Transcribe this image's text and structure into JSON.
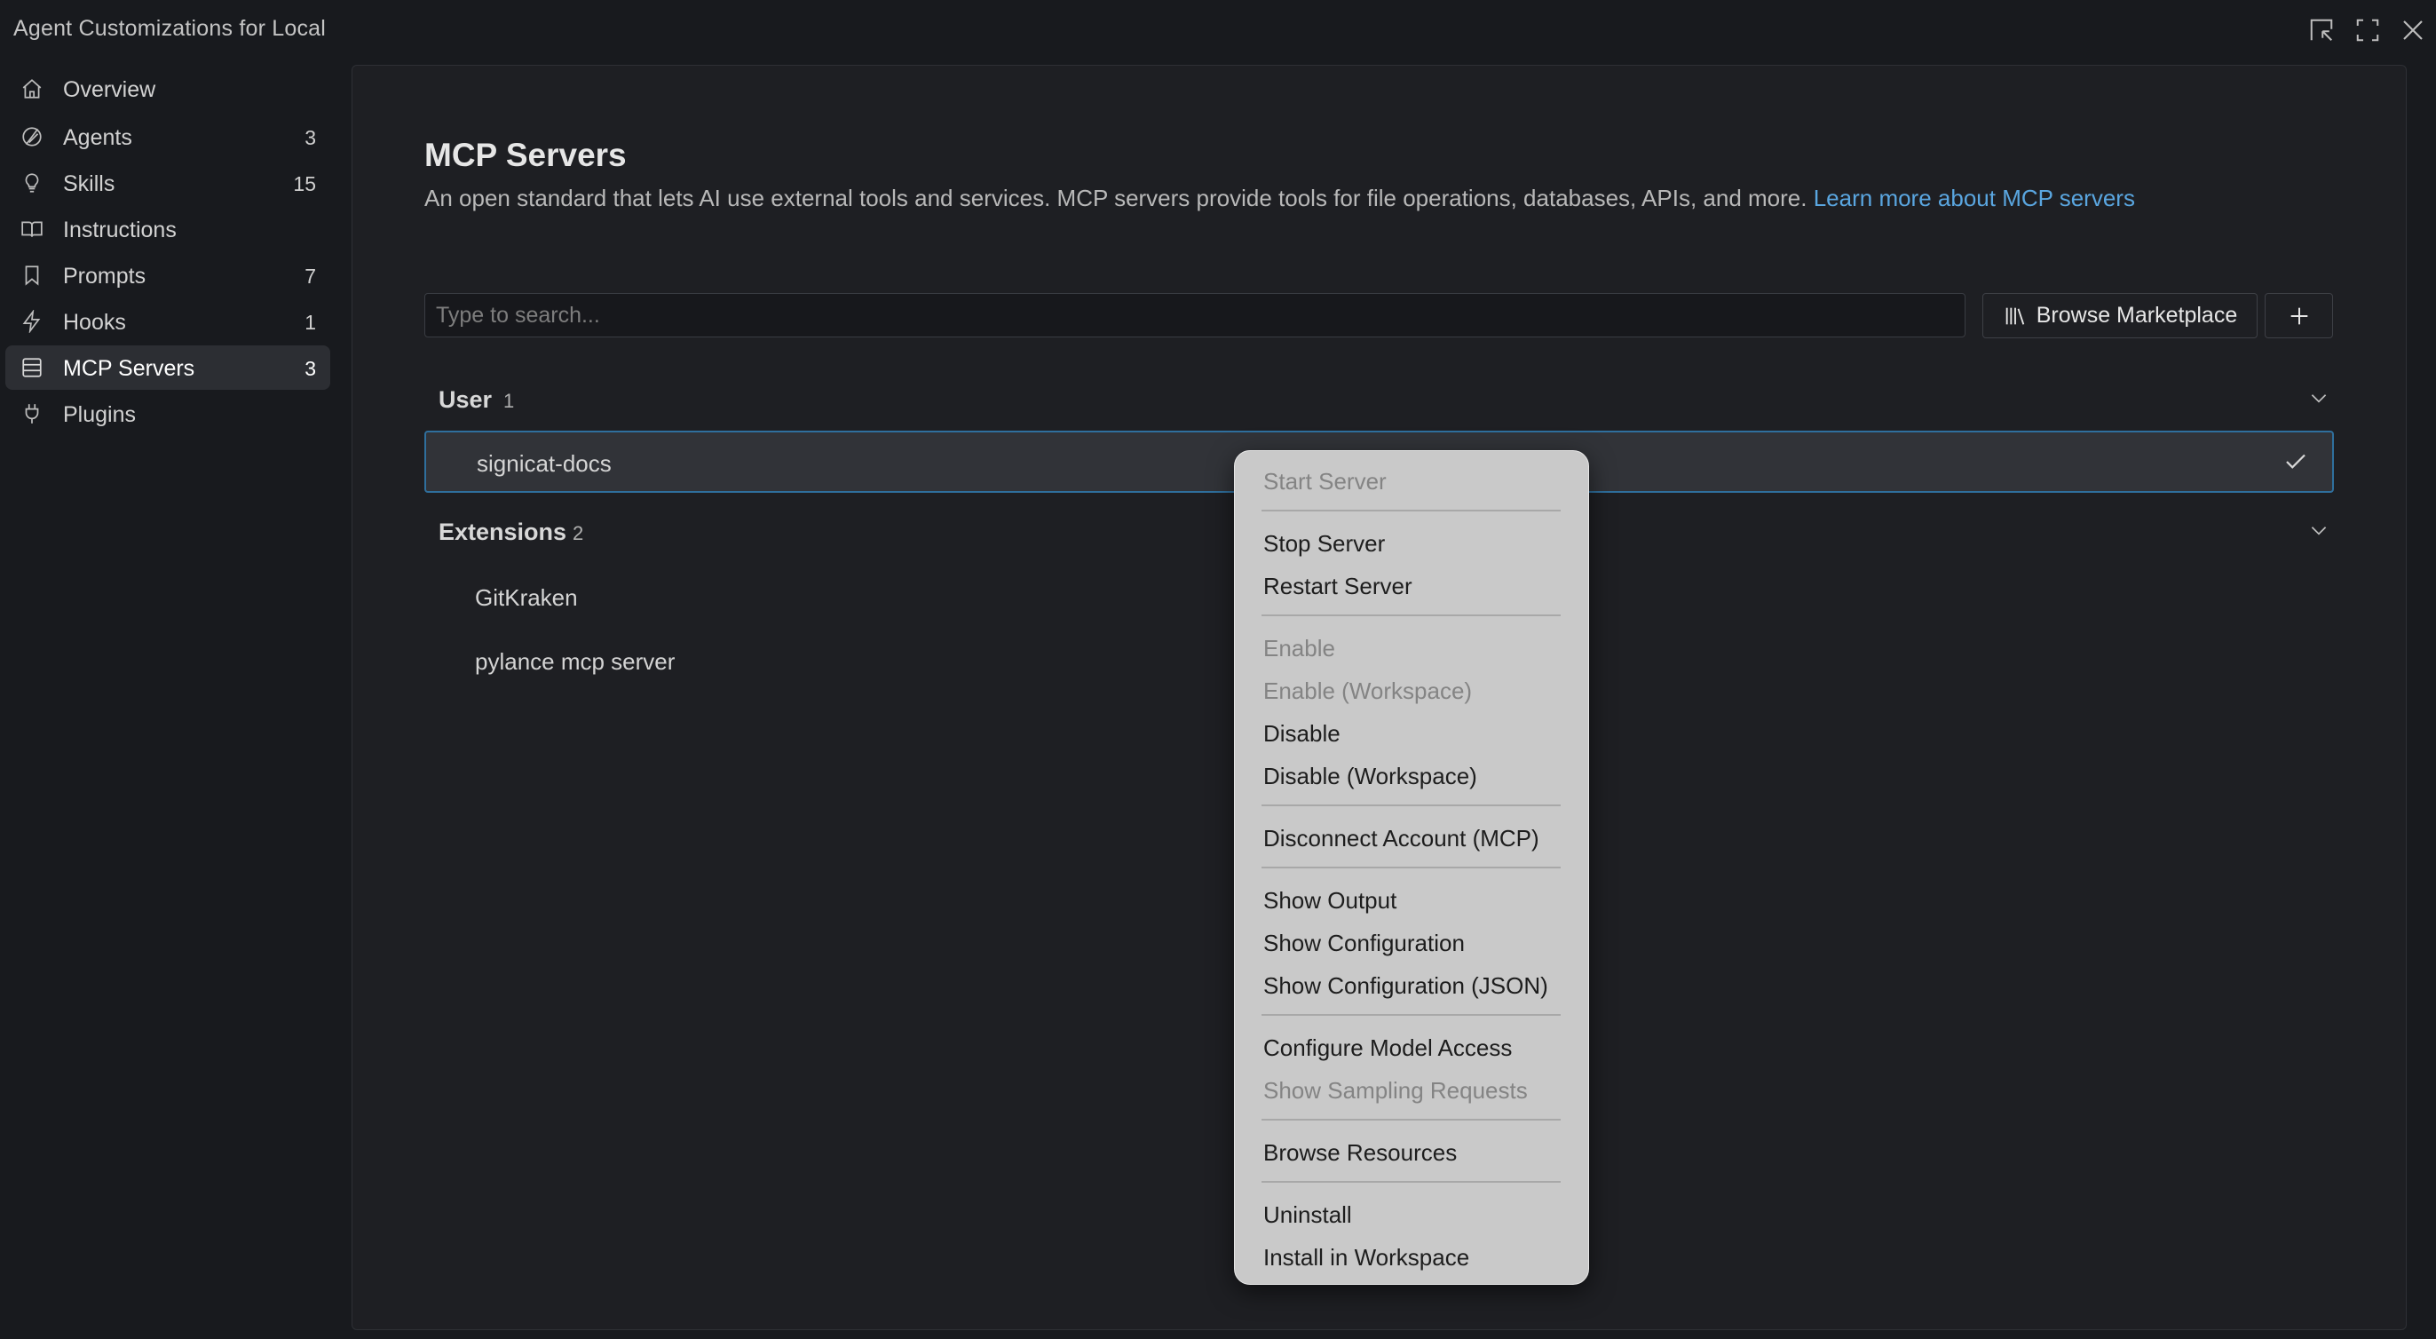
{
  "window": {
    "title": "Agent Customizations for Local",
    "controls": [
      "pin-icon",
      "maximize-icon",
      "close-icon"
    ]
  },
  "sidebar": {
    "items": [
      {
        "label": "Overview",
        "count": "",
        "icon": "home-icon"
      },
      {
        "label": "Agents",
        "count": "3",
        "icon": "agent-icon"
      },
      {
        "label": "Skills",
        "count": "15",
        "icon": "lightbulb-icon"
      },
      {
        "label": "Instructions",
        "count": "",
        "icon": "book-icon"
      },
      {
        "label": "Prompts",
        "count": "7",
        "icon": "bookmark-icon"
      },
      {
        "label": "Hooks",
        "count": "1",
        "icon": "lightning-icon"
      },
      {
        "label": "MCP Servers",
        "count": "3",
        "icon": "server-icon",
        "active": true
      },
      {
        "label": "Plugins",
        "count": "",
        "icon": "plug-icon"
      }
    ]
  },
  "main": {
    "title": "MCP Servers",
    "description": "An open standard that lets AI use external tools and services. MCP servers provide tools for file operations, databases, APIs, and more.",
    "learn_more": "Learn more about MCP servers",
    "search_placeholder": "Type to search...",
    "search_value": "",
    "browse_label": "Browse Marketplace",
    "sections": [
      {
        "name": "User",
        "count": "1",
        "servers": [
          {
            "name": "signicat-docs",
            "selected": true
          }
        ]
      },
      {
        "name": "Extensions",
        "count": "2",
        "servers": [
          {
            "name": "GitKraken"
          },
          {
            "name": "pylance mcp server"
          }
        ]
      }
    ]
  },
  "context_menu": {
    "groups": [
      [
        {
          "label": "Start Server",
          "disabled": true
        }
      ],
      [
        {
          "label": "Stop Server"
        },
        {
          "label": "Restart Server"
        }
      ],
      [
        {
          "label": "Enable",
          "disabled": true
        },
        {
          "label": "Enable (Workspace)",
          "disabled": true
        },
        {
          "label": "Disable"
        },
        {
          "label": "Disable (Workspace)"
        }
      ],
      [
        {
          "label": "Disconnect Account (MCP)"
        }
      ],
      [
        {
          "label": "Show Output"
        },
        {
          "label": "Show Configuration"
        },
        {
          "label": "Show Configuration (JSON)"
        }
      ],
      [
        {
          "label": "Configure Model Access"
        },
        {
          "label": "Show Sampling Requests",
          "disabled": true
        }
      ],
      [
        {
          "label": "Browse Resources"
        }
      ],
      [
        {
          "label": "Uninstall"
        },
        {
          "label": "Install in Workspace"
        }
      ]
    ]
  },
  "colors": {
    "background": "#181a1e",
    "panel": "#1e1f23",
    "accent_link": "#5aa6e0",
    "selection_border": "#2f6f9d",
    "menu_background": "#c9c9c9"
  }
}
